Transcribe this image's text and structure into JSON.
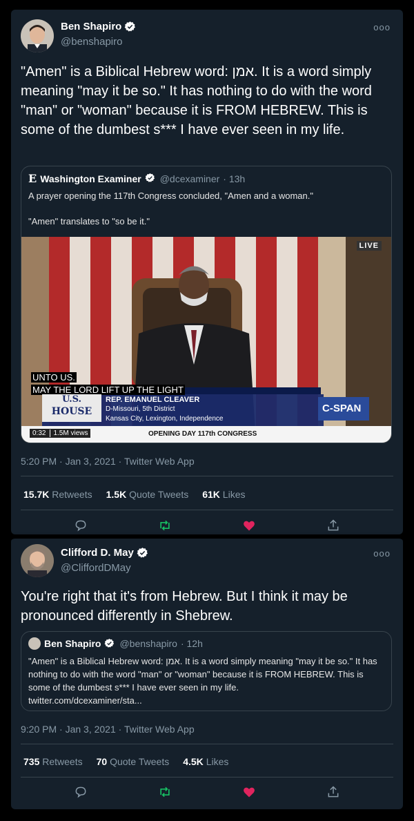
{
  "tweet1": {
    "author_name": "Ben Shapiro",
    "author_handle": "@benshapiro",
    "more_label": "ooo",
    "text": "\"Amen\" is a Biblical Hebrew word: אמן. It is a word simply meaning \"may it be so.\" It has nothing to do with the word \"man\" or \"woman\" because it is FROM HEBREW. This is some of the dumbest s*** I have ever seen in my life.",
    "quote": {
      "logo": "E",
      "name": "Washington Examiner",
      "handle": "@dcexaminer",
      "time": "· 13h",
      "text_line1": "A prayer opening the 117th Congress concluded, \"Amen and a woman.\"",
      "text_line2": "\"Amen\" translates to \"so be it.\"",
      "video": {
        "live_badge": "LIVE",
        "caption_line1": "UNTO US.",
        "caption_line2": "MAY THE LORD LIFT UP THE LIGHT",
        "house_logo_line1": "U.S.",
        "house_logo_line2": "HOUSE",
        "lower_third_name": "REP. EMANUEL CLEAVER",
        "lower_third_district": "D-Missouri, 5th District",
        "lower_third_location": "Kansas City, Lexington, Independence",
        "network": "C-SPAN",
        "duration": "0:32",
        "views": "1.5M views",
        "bottom_banner": "OPENING DAY 117th CONGRESS"
      }
    },
    "timestamp": "5:20 PM · Jan 3, 2021 · Twitter Web App",
    "retweets_count": "15.7K",
    "retweets_label": "Retweets",
    "quotes_count": "1.5K",
    "quotes_label": "Quote Tweets",
    "likes_count": "61K",
    "likes_label": "Likes"
  },
  "tweet2": {
    "author_name": "Clifford D. May",
    "author_handle": "@CliffordDMay",
    "more_label": "ooo",
    "text": "You're right that it's from Hebrew. But I think it may be pronounced differently in Shebrew.",
    "quote": {
      "name": "Ben Shapiro",
      "handle": "@benshapiro",
      "time": "· 12h",
      "text": "\"Amen\" is a Biblical Hebrew word: אמן. It is a word simply meaning \"may it be so.\" It has nothing to do with the word \"man\" or \"woman\" because it is FROM HEBREW. This is some of the dumbest s*** I have ever seen in my life.",
      "link": "twitter.com/dcexaminer/sta..."
    },
    "timestamp": "9:20 PM · Jan 3, 2021 · Twitter Web App",
    "retweets_count": "735",
    "retweets_label": "Retweets",
    "quotes_count": "70",
    "quotes_label": "Quote Tweets",
    "likes_count": "4.5K",
    "likes_label": "Likes"
  },
  "colors": {
    "background": "#15202b",
    "verified": "#ffffff",
    "retweet_green": "#17bf63",
    "like_red": "#e0245e",
    "muted": "#8899a6"
  }
}
